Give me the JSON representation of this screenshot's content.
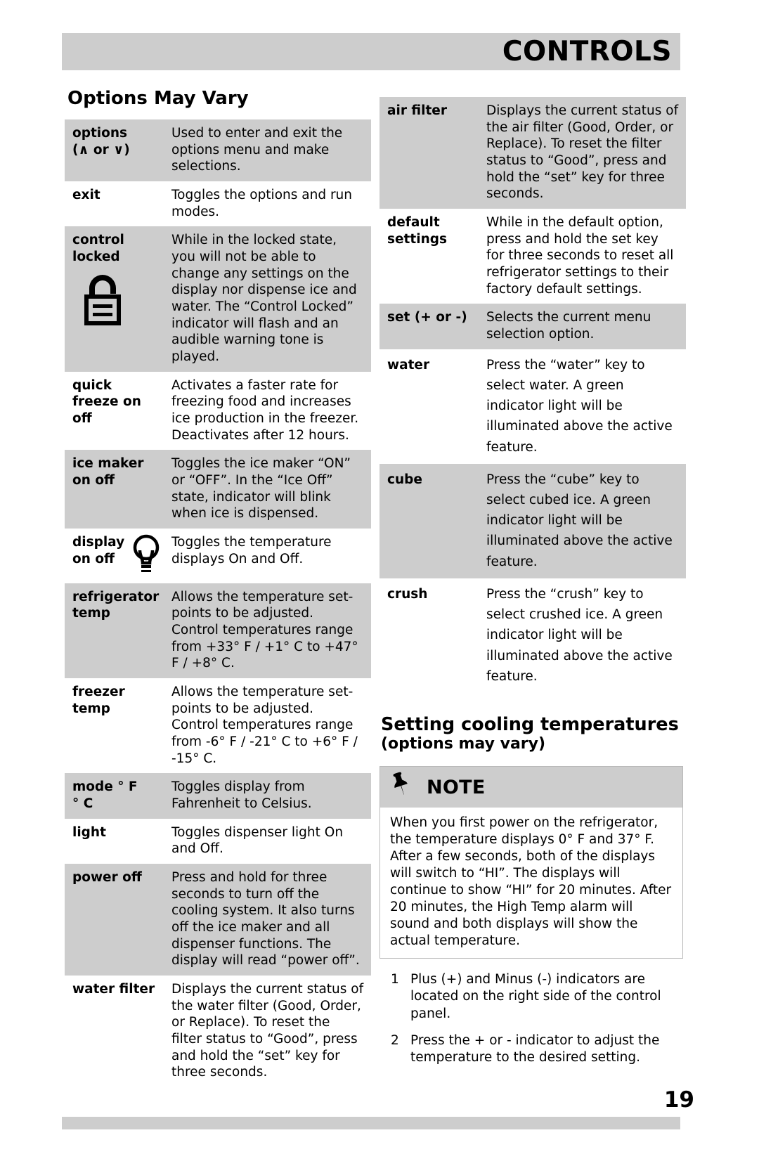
{
  "header": {
    "title": "CONTROLS"
  },
  "left": {
    "section_title": "Options May Vary",
    "rows": [
      {
        "term_line1": "options",
        "term_line2": "(∧ or ∨)",
        "desc": "Used to enter and exit the options menu and make selections.",
        "shaded": true
      },
      {
        "term_line1": "exit",
        "term_line2": "",
        "desc": "Toggles the options and run modes.",
        "shaded": false
      },
      {
        "term_line1": "control",
        "term_line2": "locked",
        "icon": "lock-icon",
        "desc": "While in the locked state, you will not be able to change any settings on the display nor dispense ice and water. The “Control Locked” indicator will flash and an audible warning tone is played.",
        "shaded": true
      },
      {
        "term_line1": "quick",
        "term_line2": "freeze on",
        "term_line3": "off",
        "desc": "Activates a faster rate for freezing food and increases ice production in the freezer. Deactivates after 12 hours.",
        "shaded": false
      },
      {
        "term_line1": "ice maker",
        "term_line2": "on off",
        "desc": "Toggles the ice maker “ON” or “OFF”. In the “Ice Off” state, indicator will blink when ice is dispensed.",
        "shaded": true
      },
      {
        "term_line1": "display",
        "term_line2": "on off",
        "icon": "lightbulb-icon",
        "desc": "Toggles the temperature displays On and Off.",
        "shaded": false
      },
      {
        "term_line1": "refrigerator",
        "term_line2": "temp",
        "desc": "Allows the temperature set-points to be adjusted. Control temperatures range from +33° F / +1° C to +47° F / +8° C.",
        "shaded": true
      },
      {
        "term_line1": "freezer",
        "term_line2": "temp",
        "desc": "Allows the temperature set-points to be adjusted. Control temperatures range from -6° F / -21° C to +6° F / -15° C.",
        "shaded": false
      },
      {
        "term_line1": "mode ° F",
        "term_line2": "° C",
        "desc": "Toggles display from Fahrenheit to Celsius.",
        "shaded": true
      },
      {
        "term_line1": "light",
        "term_line2": "",
        "desc": "Toggles dispenser light On and Off.",
        "shaded": false
      },
      {
        "term_line1": "power off",
        "term_line2": "",
        "desc": "Press and hold for three seconds to turn off the cooling system. It also turns off the ice maker and all dispenser functions. The display will read “power off”.",
        "shaded": true
      },
      {
        "term_line1": "water filter",
        "term_line2": "",
        "desc": "Displays the current status of the water filter (Good, Order, or Replace). To reset the filter status to “Good”, press and hold the “set” key for three seconds.",
        "shaded": false
      }
    ]
  },
  "right": {
    "rows": [
      {
        "term_line1": "air filter",
        "term_line2": "",
        "desc": "Displays the current status of the air filter (Good, Order, or Replace). To reset the filter status to “Good”, press and hold the “set” key for three seconds.",
        "shaded": true,
        "loose": false
      },
      {
        "term_line1": "default",
        "term_line2": "settings",
        "desc": "While in the default option, press and hold the set key for three seconds to reset all refrigerator settings to their factory default settings.",
        "shaded": false,
        "loose": false
      },
      {
        "term_line1": "set (+ or -)",
        "term_line2": "",
        "desc": "Selects the current menu selection option.",
        "shaded": true,
        "loose": false
      },
      {
        "term_line1": "water",
        "term_line2": "",
        "desc": "Press the “water” key to select water. A green indicator light will be illuminated above the active feature.",
        "shaded": false,
        "loose": true
      },
      {
        "term_line1": "cube",
        "term_line2": "",
        "desc": "Press the “cube” key to select cubed ice. A green indicator light will be illuminated above the active feature.",
        "shaded": true,
        "loose": true
      },
      {
        "term_line1": "crush",
        "term_line2": "",
        "desc": "Press the “crush” key to select crushed ice. A green indicator light will be illuminated above the active feature.",
        "shaded": false,
        "loose": true
      }
    ],
    "sub_head": "Setting cooling temperatures",
    "sub_head_small": "(options may vary)",
    "note": {
      "label": "NOTE",
      "icon": "pushpin-icon",
      "body": "When you first power on the refrigerator, the temperature displays 0° F and 37° F. After a few seconds, both of the displays will switch to “HI”. The displays will continue to show “HI” for 20 minutes. After 20 minutes, the High Temp alarm will sound and both displays will show the actual temperature."
    },
    "steps": [
      "Plus (+) and Minus (-) indicators are located on the right side of the control panel.",
      "Press the + or - indicator to adjust the temperature to the desired setting."
    ]
  },
  "footer": {
    "page_number": "19"
  },
  "colors": {
    "shade": "#cdcdcd",
    "text": "#000000",
    "page": "#ffffff"
  }
}
